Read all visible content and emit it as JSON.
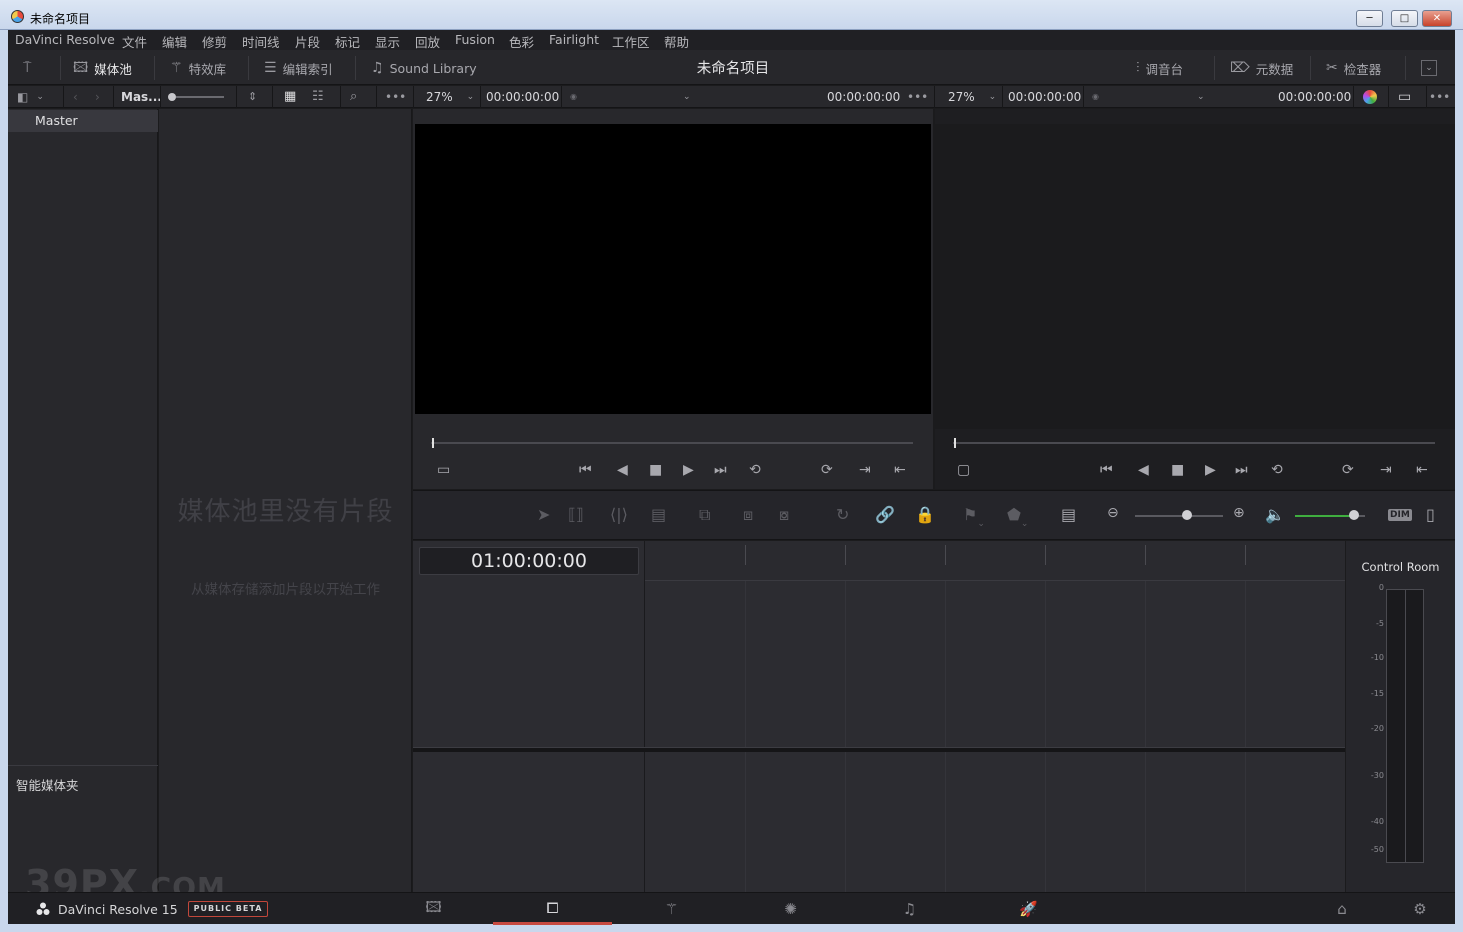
{
  "window": {
    "title": "未命名项目",
    "minimize": "─",
    "maximize": "□",
    "close": "✕"
  },
  "menu": [
    "DaVinci Resolve",
    "文件",
    "编辑",
    "修剪",
    "时间线",
    "片段",
    "标记",
    "显示",
    "回放",
    "Fusion",
    "色彩",
    "Fairlight",
    "工作区",
    "帮助"
  ],
  "toolbar": {
    "media_pool": "媒体池",
    "effects_library": "特效库",
    "edit_index": "编辑索引",
    "sound_library": "Sound Library",
    "project_title": "未命名项目",
    "mixer": "调音台",
    "metadata": "元数据",
    "inspector": "检查器"
  },
  "subbar": {
    "bin_name": "Mas...",
    "source_zoom": "27%",
    "source_tc_left": "00:00:00:00",
    "source_tc_right": "00:00:00:00",
    "timeline_zoom": "27%",
    "timeline_tc_left": "00:00:00:00",
    "timeline_tc_right": "00:00:00:00"
  },
  "bins": {
    "master": "Master",
    "smart_bins": "智能媒体夹"
  },
  "media_pool": {
    "empty_title": "媒体池里没有片段",
    "empty_subtitle": "从媒体存储添加片段以开始工作"
  },
  "timeline": {
    "timecode": "01:00:00:00"
  },
  "control_room": {
    "title": "Control Room",
    "scale": [
      "0",
      "-5",
      "-10",
      "-15",
      "-20",
      "-30",
      "-40",
      "-50"
    ],
    "dim_label": "DIM"
  },
  "bottom": {
    "brand": "DaVinci Resolve 15",
    "badge": "PUBLIC BETA",
    "watermark": "39PX",
    "watermark_suffix": ".COM",
    "active_page": "edit"
  },
  "colors": {
    "accent_red": "#c84a40",
    "volume_green": "#3fae3f"
  }
}
